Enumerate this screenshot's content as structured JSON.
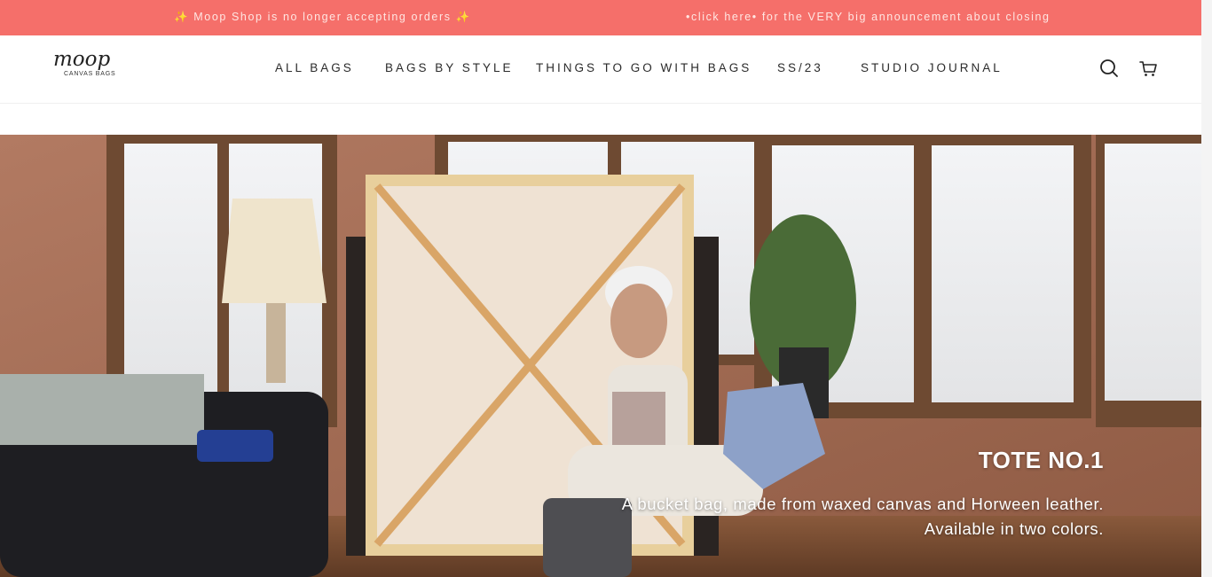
{
  "announcement": {
    "left": "Moop Shop is no longer accepting orders",
    "right": "•click here• for the VERY big announcement about closing",
    "sparkle": "✨"
  },
  "header": {
    "logo_text": "moop",
    "logo_subtext": "CANVAS BAGS",
    "nav": [
      {
        "label": "ALL BAGS"
      },
      {
        "label": "BAGS BY STYLE"
      },
      {
        "label": "THINGS TO GO WITH BAGS"
      },
      {
        "label": "SS/23"
      },
      {
        "label": "STUDIO JOURNAL"
      }
    ],
    "icons": [
      "search-icon",
      "cart-icon"
    ]
  },
  "hero": {
    "title": "TOTE NO.1",
    "description_line1": "A bucket bag, made from waxed canvas and Horween leather.",
    "description_line2": "Available in two colors."
  },
  "colors": {
    "announcement_bg": "#f56f6a",
    "text_dark": "#2b2b2b"
  }
}
